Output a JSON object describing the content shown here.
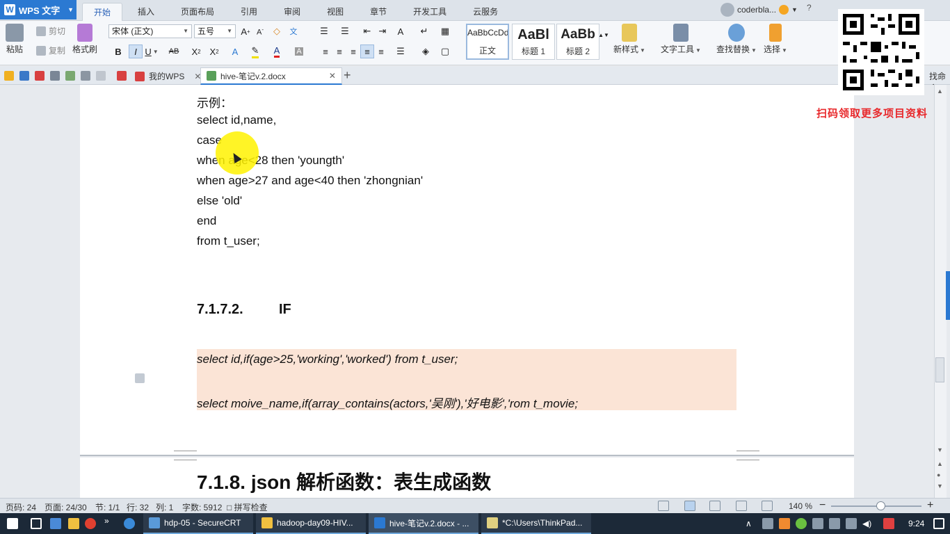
{
  "app": {
    "name": "WPS 文字"
  },
  "menu_tabs": [
    "开始",
    "插入",
    "页面布局",
    "引用",
    "审阅",
    "视图",
    "章节",
    "开发工具",
    "云服务"
  ],
  "user": {
    "name": "coderbla..."
  },
  "ribbon": {
    "paste": "粘贴",
    "cut": "剪切",
    "copy": "复制",
    "format_painter": "格式刷",
    "font_name": "宋体 (正文)",
    "font_size": "五号",
    "styles": [
      {
        "preview": "AaBbCcDd",
        "label": "正文"
      },
      {
        "preview": "AaBl",
        "label": "标题 1"
      },
      {
        "preview": "AaBb",
        "label": "标题 2"
      }
    ],
    "new_style": "新样式",
    "text_tools": "文字工具",
    "find_replace": "查找替换",
    "select": "选择"
  },
  "doc_tabs": [
    {
      "label": "我的WPS"
    },
    {
      "label": "hive-笔记v.2.docx"
    }
  ],
  "cmd_hint": "找命令",
  "document": {
    "lines": [
      "示例：",
      "select id,name,",
      "case",
      "when age<28 then 'youngth'",
      "when age>27 and age<40 then 'zhongnian'",
      "else 'old'",
      "end",
      "from t_user;"
    ],
    "heading_num": "7.1.7.2.",
    "heading_text": "IF",
    "code_lines": [
      "select id,if(age>25,'working','worked') from t_user;",
      "select moive_name,if(array_contains(actors,'吴刚'),'好电影','rom t_movie;"
    ],
    "h2": "7.1.8. json 解析函数：表生成函数"
  },
  "promo": "扫码领取更多项目资料",
  "status": {
    "page_no": "页码: 24",
    "pages": "页面: 24/30",
    "section": "节: 1/1",
    "row": "行: 32",
    "col": "列: 1",
    "words": "字数: 5912",
    "spell": "拼写检查",
    "zoom": "140 %"
  },
  "taskbar": {
    "apps": [
      {
        "label": "hdp-05 - SecureCRT"
      },
      {
        "label": "hadoop-day09-HIV..."
      },
      {
        "label": "hive-笔记v.2.docx - ..."
      },
      {
        "label": "*C:\\Users\\ThinkPad..."
      }
    ],
    "clock": "9:24"
  },
  "colors": {
    "accent": "#2b79d2",
    "code_bg": "#fbe4d6",
    "promo": "#e8282b",
    "taskbar": "#1c2938"
  }
}
